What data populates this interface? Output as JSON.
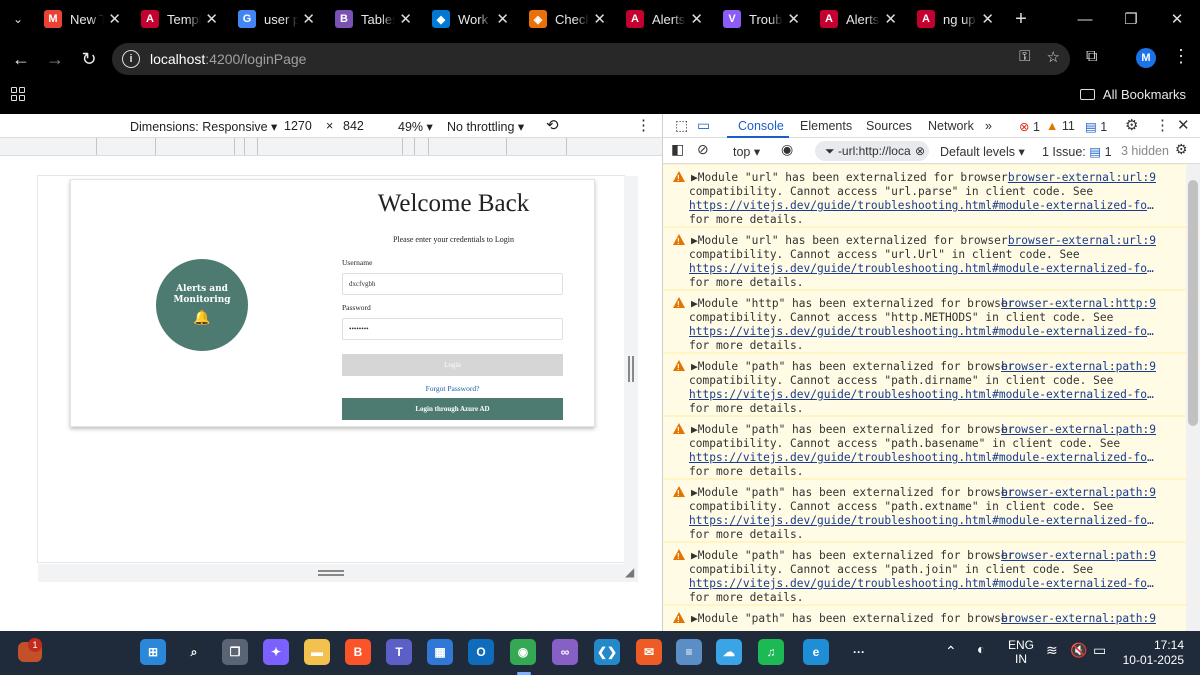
{
  "browser": {
    "tabs": [
      {
        "label": "New T",
        "icon": "gmail-icon",
        "color": "#ea4335",
        "glyph": "M"
      },
      {
        "label": "Templ",
        "icon": "angular-icon",
        "color": "#c3002f",
        "glyph": "A"
      },
      {
        "label": "user p",
        "icon": "google-icon",
        "color": "#4285f4",
        "glyph": "G"
      },
      {
        "label": "Tables",
        "icon": "bootstrap-icon",
        "color": "#7952b3",
        "glyph": "B"
      },
      {
        "label": "Work",
        "icon": "azure-devops-icon",
        "color": "#0078d4",
        "glyph": "◆"
      },
      {
        "label": "Check",
        "icon": "shield-icon",
        "color": "#e8710a",
        "glyph": "◈"
      },
      {
        "label": "Alerts",
        "icon": "angular-icon",
        "color": "#c3002f",
        "glyph": "A"
      },
      {
        "label": "Troub",
        "icon": "vite-icon",
        "color": "#8b5cf6",
        "glyph": "V"
      },
      {
        "label": "Alerts",
        "icon": "angular-icon",
        "color": "#c3002f",
        "glyph": "A"
      },
      {
        "label": "ng up",
        "icon": "angular-icon",
        "color": "#c3002f",
        "glyph": "A"
      }
    ],
    "url_host": "localhost",
    "url_rest": ":4200/loginPage",
    "profile_initial": "M",
    "all_bookmarks": "All Bookmarks"
  },
  "device_toolbar": {
    "dimensions": "Dimensions: Responsive",
    "width": "1270",
    "height": "842",
    "times": "×",
    "zoom": "49%",
    "throttling": "No throttling"
  },
  "login_page": {
    "badge_title": "Alerts and Monitoring",
    "welcome": "Welcome Back",
    "subtitle": "Please enter your credentials to Login",
    "username_label": "Username",
    "username_value": "dxcfvgbh",
    "password_label": "Password",
    "password_value": "••••••••",
    "login_button": "Login",
    "forgot_password": "Forgot Password?",
    "azure_button": "Login through Azure AD",
    "colors": {
      "primary": "#4e7b71",
      "disabled": "#d6d6d6"
    }
  },
  "devtools": {
    "tabs": [
      "Console",
      "Elements",
      "Sources",
      "Network"
    ],
    "active_tab": "Console",
    "errors": "1",
    "warnings": "11",
    "infos": "1",
    "context": "top",
    "filter": "-url:http://loca",
    "levels": "Default levels",
    "issues_label": "1 Issue:",
    "issues_count": "1",
    "hidden": "3 hidden",
    "messages": [
      {
        "line1": "Module \"url\" has been externalized for browser",
        "source": "browser-external:url:9",
        "line2": "compatibility. Cannot access \"url.parse\" in client code. See",
        "link": "https://vitejs.dev/guide/troubleshooting.html#module-externalized-for-browser-compatibility",
        "line4": "for more details."
      },
      {
        "line1": "Module \"url\" has been externalized for browser",
        "source": "browser-external:url:9",
        "line2": "compatibility. Cannot access \"url.Url\" in client code. See",
        "link": "https://vitejs.dev/guide/troubleshooting.html#module-externalized-for-browser-compatibility",
        "line4": "for more details."
      },
      {
        "line1": "Module \"http\" has been externalized for browser",
        "source": "browser-external:http:9",
        "line2": "compatibility. Cannot access \"http.METHODS\" in client code. See",
        "link": "https://vitejs.dev/guide/troubleshooting.html#module-externalized-for-browser-compatibility",
        "line4": "for more details."
      },
      {
        "line1": "Module \"path\" has been externalized for browser",
        "source": "browser-external:path:9",
        "line2": "compatibility. Cannot access \"path.dirname\" in client code. See",
        "link": "https://vitejs.dev/guide/troubleshooting.html#module-externalized-for-browser-compatibility",
        "line4": "for more details."
      },
      {
        "line1": "Module \"path\" has been externalized for browser",
        "source": "browser-external:path:9",
        "line2": "compatibility. Cannot access \"path.basename\" in client code. See",
        "link": "https://vitejs.dev/guide/troubleshooting.html#module-externalized-for-browser-compatibility",
        "line4": "for more details."
      },
      {
        "line1": "Module \"path\" has been externalized for browser",
        "source": "browser-external:path:9",
        "line2": "compatibility. Cannot access \"path.extname\" in client code. See",
        "link": "https://vitejs.dev/guide/troubleshooting.html#module-externalized-for-browser-compatibility",
        "line4": "for more details."
      },
      {
        "line1": "Module \"path\" has been externalized for browser",
        "source": "browser-external:path:9",
        "line2": "compatibility. Cannot access \"path.join\" in client code. See",
        "link": "https://vitejs.dev/guide/troubleshooting.html#module-externalized-for-browser-compatibility",
        "line4": "for more details."
      },
      {
        "line1": "Module \"path\" has been externalized for browser",
        "source": "browser-external:path:9",
        "line2": "",
        "link": "",
        "line4": ""
      }
    ]
  },
  "taskbar": {
    "weather_badge": "1",
    "apps": [
      {
        "name": "start-icon",
        "color": "#2b88d8",
        "glyph": "⊞"
      },
      {
        "name": "search-icon",
        "color": "transparent",
        "glyph": "⌕"
      },
      {
        "name": "task-view-icon",
        "color": "#5a6474",
        "glyph": "❐"
      },
      {
        "name": "copilot-icon",
        "color": "#7b61ff",
        "glyph": "✦"
      },
      {
        "name": "file-explorer-icon",
        "color": "#f2c14e",
        "glyph": "▬"
      },
      {
        "name": "brave-icon",
        "color": "#fb542b",
        "glyph": "B"
      },
      {
        "name": "teams-icon",
        "color": "#5b5fc7",
        "glyph": "T"
      },
      {
        "name": "store-icon",
        "color": "#2f78d6",
        "glyph": "▦"
      },
      {
        "name": "outlook-icon",
        "color": "#0f6cbd",
        "glyph": "O"
      },
      {
        "name": "chrome-icon",
        "color": "#34a853",
        "glyph": "◉"
      },
      {
        "name": "visual-studio-icon",
        "color": "#8660c5",
        "glyph": "∞"
      },
      {
        "name": "vscode-icon",
        "color": "#2489ca",
        "glyph": "❮❯"
      },
      {
        "name": "postman-icon",
        "color": "#ef5b25",
        "glyph": "✉"
      },
      {
        "name": "notepad-icon",
        "color": "#5b8ec4",
        "glyph": "≡"
      },
      {
        "name": "cloud-icon",
        "color": "#3ba4e6",
        "glyph": "☁"
      },
      {
        "name": "spotify-icon",
        "color": "#1db954",
        "glyph": "♫"
      },
      {
        "name": "edge-icon",
        "color": "#1e8fd6",
        "glyph": "e"
      },
      {
        "name": "more-apps-icon",
        "color": "transparent",
        "glyph": "···"
      }
    ],
    "language": "ENG",
    "region": "IN",
    "time": "17:14",
    "date": "10-01-2025"
  }
}
